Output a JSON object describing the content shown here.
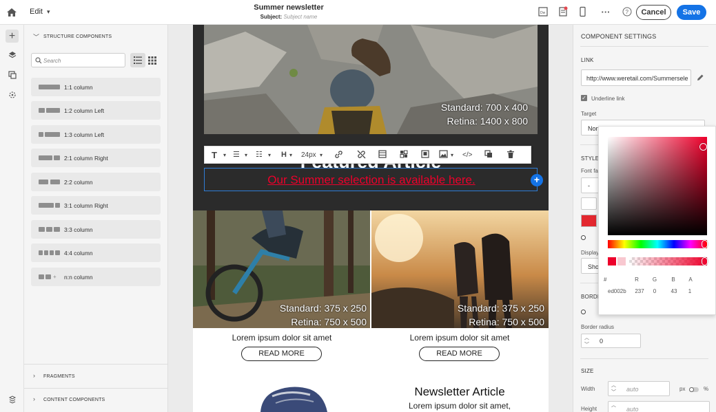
{
  "topbar": {
    "edit_label": "Edit",
    "title": "Summer newsletter",
    "subject_label": "Subject:",
    "subject_placeholder": "Subject name",
    "cancel_label": "Cancel",
    "save_label": "Save",
    "icons": [
      "home-icon",
      "chevron-down-icon",
      "mobile-preview-icon",
      "validation-icon",
      "device-icon",
      "more-icon",
      "help-icon"
    ]
  },
  "left_panel": {
    "structure_title": "STRUCTURE COMPONENTS",
    "search_placeholder": "Search",
    "components": [
      "1:1 column",
      "1:2 column Left",
      "1:3 column Left",
      "2:1 column Right",
      "2:2 column",
      "3:1 column Right",
      "3:3 column",
      "4:4 column",
      "n:n column"
    ],
    "fragments_title": "FRAGMENTS",
    "content_title": "CONTENT COMPONENTS"
  },
  "email": {
    "hero_image_text_1": "Standard: 700 x 400",
    "hero_image_text_2": "Retina: 1400 x 800",
    "heading_partial": "Featured Article",
    "link_text": "Our Summer selection is available here.",
    "font_size": "24px",
    "col1": {
      "img_text_1": "Standard: 375 x 250",
      "img_text_2": "Retina: 750 x 500",
      "lorem": "Lorem ipsum dolor sit amet",
      "button": "READ MORE"
    },
    "col2": {
      "img_text_1": "Standard: 375 x 250",
      "img_text_2": "Retina: 750 x 500",
      "lorem": "Lorem ipsum dolor sit amet",
      "button": "READ MORE"
    },
    "article_title": "Newsletter Article",
    "article_lorem": "Lorem ipsum dolor sit amet,"
  },
  "right_panel": {
    "title": "COMPONENT SETTINGS",
    "link_heading": "LINK",
    "link_value": "http://www.weretail.com/Summersele",
    "underline_label": "Underline link",
    "target_label": "Target",
    "target_value": "Non",
    "style_heading": "STYLE",
    "font_family_label": "Font fa",
    "font_family_value": "-",
    "display_label": "Display",
    "display_value": "Sho",
    "border_heading": "BORDE",
    "border_radius_label": "Border radius",
    "border_radius_value": "0",
    "size_heading": "SIZE",
    "width_label": "Width",
    "width_placeholder": "auto",
    "unit_px": "px",
    "unit_pct": "%",
    "height_label": "Height",
    "height_placeholder": "auto"
  },
  "color_picker": {
    "hash_label": "#",
    "r_label": "R",
    "g_label": "G",
    "b_label": "B",
    "a_label": "A",
    "hex": "ed002b",
    "r": "237",
    "g": "0",
    "b": "43",
    "a": "1",
    "color": "#ed002b"
  },
  "colors": {
    "accent": "#1473e6",
    "link_red": "#ed002b"
  }
}
